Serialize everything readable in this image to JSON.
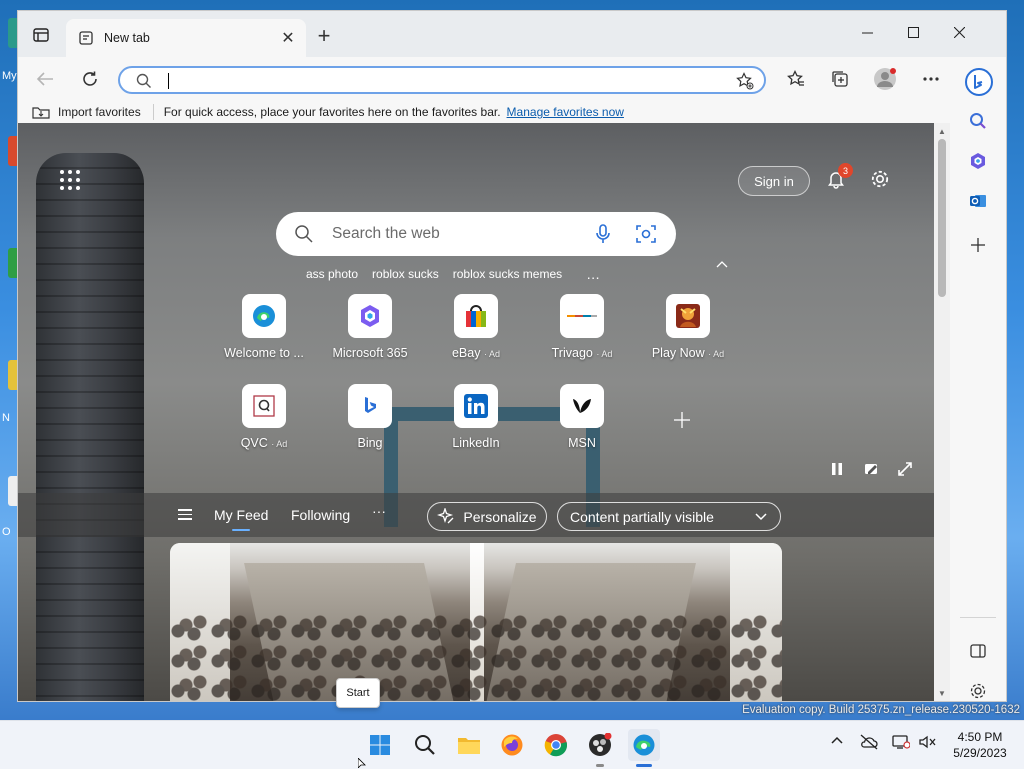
{
  "desktop": {
    "side_text_1": "My",
    "side_text_2": "N",
    "side_text_3": "O",
    "watermark": "Evaluation copy. Build 25375.zn_release.230520-1632"
  },
  "tab": {
    "title": "New tab",
    "close": "✕",
    "new_tab": "+"
  },
  "address_bar": {
    "value": "",
    "placeholder": ""
  },
  "favorites_bar": {
    "import_label": "Import favorites",
    "message": "For quick access, place your favorites here on the favorites bar.",
    "manage_link": "Manage favorites now"
  },
  "newtab_page": {
    "sign_in": "Sign in",
    "notification_count": "3",
    "search_placeholder": "Search the web",
    "trending": [
      "ass photo",
      "roblox sucks",
      "roblox sucks memes"
    ],
    "trending_more": "…",
    "tiles": [
      {
        "label": "Welcome to ...",
        "ad": "",
        "icon": "edge-icon"
      },
      {
        "label": "Microsoft 365",
        "ad": "",
        "icon": "microsoft-365-icon"
      },
      {
        "label": "eBay",
        "ad": "Ad",
        "icon": "ebay-icon"
      },
      {
        "label": "Trivago",
        "ad": "Ad",
        "icon": "trivago-icon"
      },
      {
        "label": "Play Now",
        "ad": "Ad",
        "icon": "game-icon"
      },
      {
        "label": "QVC",
        "ad": "Ad",
        "icon": "qvc-icon"
      },
      {
        "label": "Bing",
        "ad": "",
        "icon": "bing-icon"
      },
      {
        "label": "LinkedIn",
        "ad": "",
        "icon": "linkedin-icon"
      },
      {
        "label": "MSN",
        "ad": "",
        "icon": "msn-icon"
      }
    ],
    "feed": {
      "tabs": [
        "My Feed",
        "Following"
      ],
      "more": "···",
      "personalize": "Personalize",
      "content_visibility": "Content partially visible"
    }
  },
  "tooltip": {
    "start": "Start"
  },
  "clock": {
    "time": "4:50 PM",
    "date": "5/29/2023"
  },
  "colors": {
    "accent": "#0b5cad",
    "address_border": "#6ea2e8",
    "badge": "#e0462b"
  }
}
